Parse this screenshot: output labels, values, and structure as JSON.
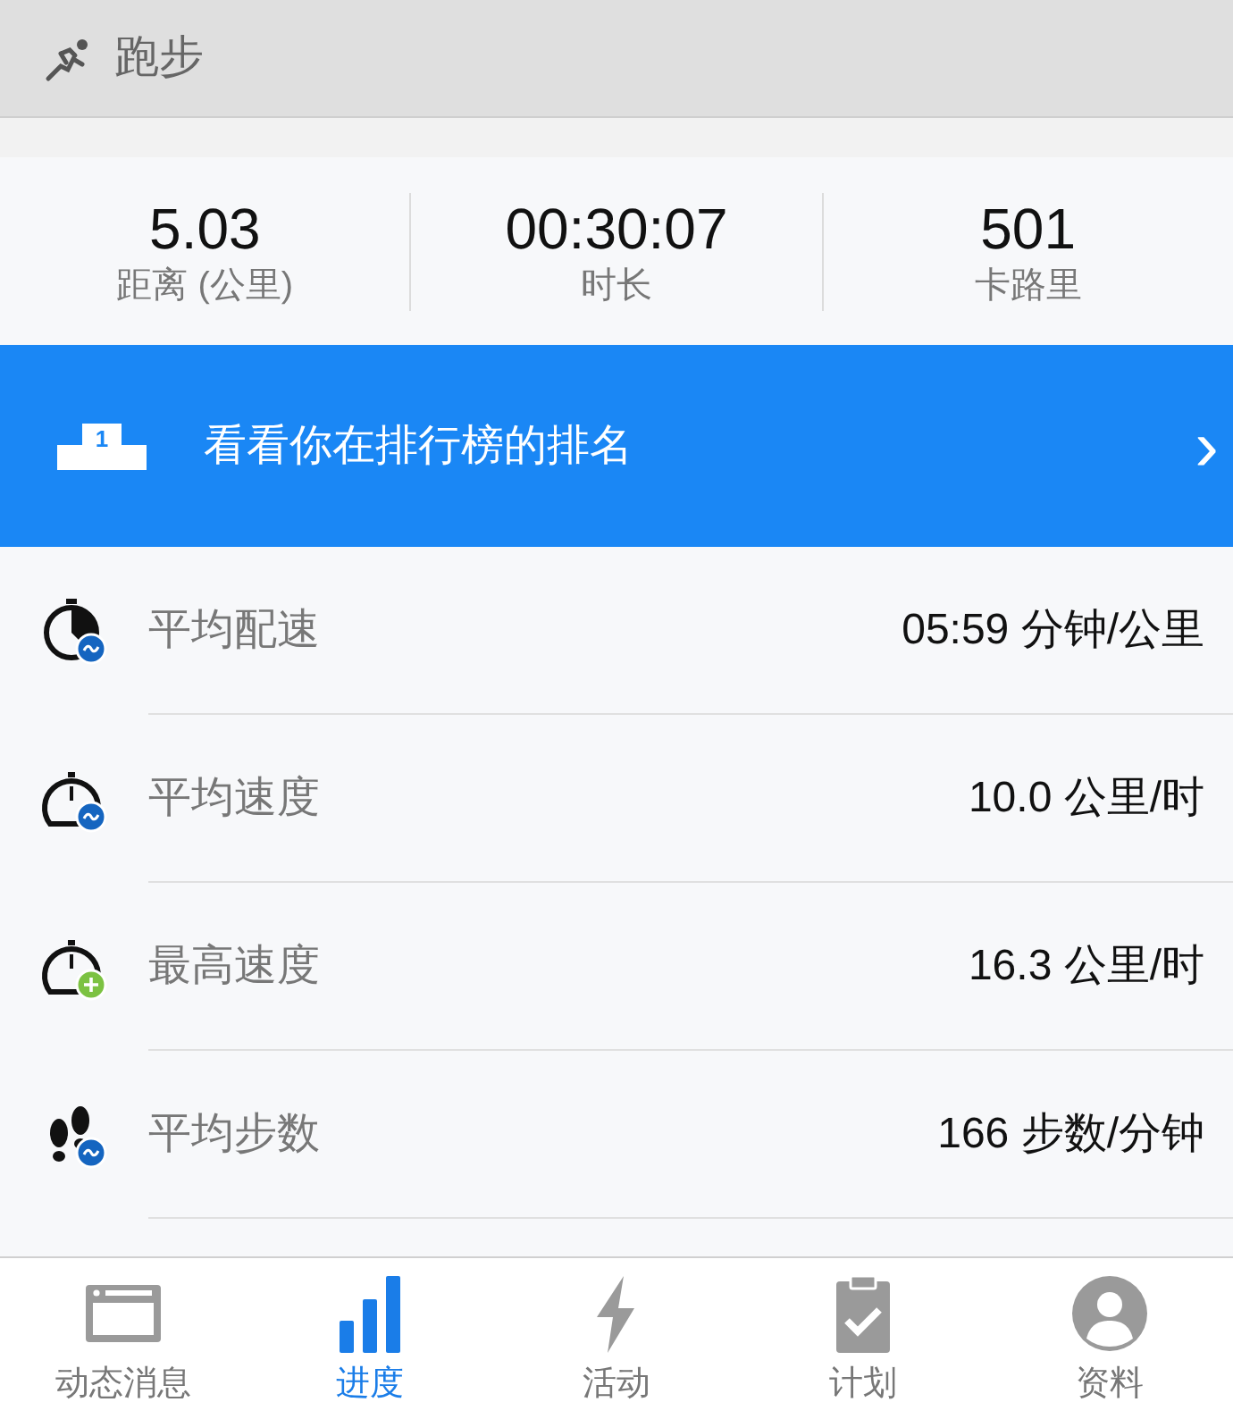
{
  "header": {
    "title": "跑步"
  },
  "stats": [
    {
      "value": "5.03",
      "label": "距离 (公里)"
    },
    {
      "value": "00:30:07",
      "label": "时长"
    },
    {
      "value": "501",
      "label": "卡路里"
    }
  ],
  "banner": {
    "text": "看看你在排行榜的排名",
    "podium": "1",
    "chevron": "›"
  },
  "metrics": [
    {
      "kind": "pace",
      "label": "平均配速",
      "value": "05:59 分钟/公里"
    },
    {
      "kind": "speed",
      "label": "平均速度",
      "value": "10.0 公里/时"
    },
    {
      "kind": "max-speed",
      "label": "最高速度",
      "value": "16.3 公里/时"
    },
    {
      "kind": "steps",
      "label": "平均步数",
      "value": "166 步数/分钟"
    }
  ],
  "tabs": [
    {
      "kind": "feed",
      "label": "动态消息",
      "selected": false
    },
    {
      "kind": "progress",
      "label": "进度",
      "selected": true
    },
    {
      "kind": "activity",
      "label": "活动",
      "selected": false
    },
    {
      "kind": "plan",
      "label": "计划",
      "selected": false
    },
    {
      "kind": "profile",
      "label": "资料",
      "selected": false
    }
  ]
}
